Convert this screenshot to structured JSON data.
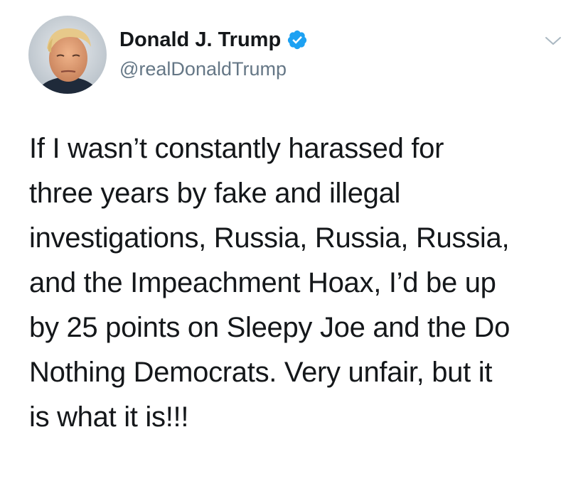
{
  "author": {
    "display_name": "Donald J. Trump",
    "handle": "@realDonaldTrump",
    "verified": true
  },
  "tweet": {
    "text": "If I wasn’t constantly harassed for\nthree years by fake and illegal\ninvestigations, Russia, Russia, Russia,\nand the Impeachment Hoax, I’d be up\nby 25 points on Sleepy Joe and the Do\nNothing Democrats. Very unfair, but it\nis what it is!!!"
  },
  "icons": {
    "verified": "verified-badge-icon",
    "menu": "chevron-down-icon"
  },
  "colors": {
    "verified_blue": "#1da1f2",
    "handle_gray": "#657786",
    "text": "#14171a",
    "caret_gray": "#aab8c2"
  }
}
